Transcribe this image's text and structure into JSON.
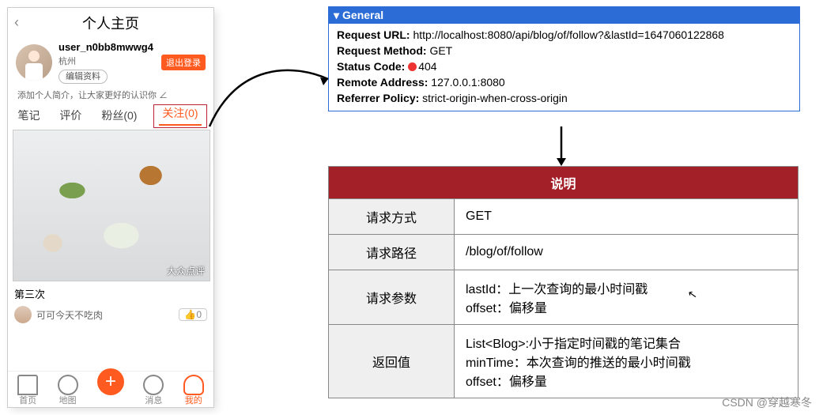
{
  "phone": {
    "title": "个人主页",
    "username": "user_n0bb8mwwg4",
    "location": "杭州",
    "edit_profile": "编辑资料",
    "logout": "退出登录",
    "bio_hint": "添加个人简介，让大家更好的认识你 ∠",
    "tabs": [
      "笔记",
      "评价",
      "粉丝(0)",
      "关注(0)"
    ],
    "food_watermark": "大众点评",
    "caption": "第三次",
    "author_line": "可可今天不吃肉",
    "like": "👍0",
    "nav": [
      "首页",
      "地图",
      "",
      "消息",
      "我的"
    ]
  },
  "devtools": {
    "title": "General",
    "lines": [
      {
        "k": "Request URL:",
        "v": "http://localhost:8080/api/blog/of/follow?&lastId=1647060122868"
      },
      {
        "k": "Request Method:",
        "v": "GET"
      },
      {
        "k": "Status Code:",
        "v": "404",
        "red": true
      },
      {
        "k": "Remote Address:",
        "v": "127.0.0.1:8080"
      },
      {
        "k": "Referrer Policy:",
        "v": "strict-origin-when-cross-origin"
      }
    ]
  },
  "table": {
    "header": "说明",
    "rows": [
      {
        "k": "请求方式",
        "v": "GET"
      },
      {
        "k": "请求路径",
        "v": "/blog/of/follow"
      },
      {
        "k": "请求参数",
        "v": "lastId：上一次查询的最小时间戳\noffset：偏移量"
      },
      {
        "k": "返回值",
        "v": "List<Blog>:小于指定时间戳的笔记集合\nminTime：本次查询的推送的最小时间戳\noffset：偏移量"
      }
    ]
  },
  "watermark": "CSDN @穿越寒冬"
}
